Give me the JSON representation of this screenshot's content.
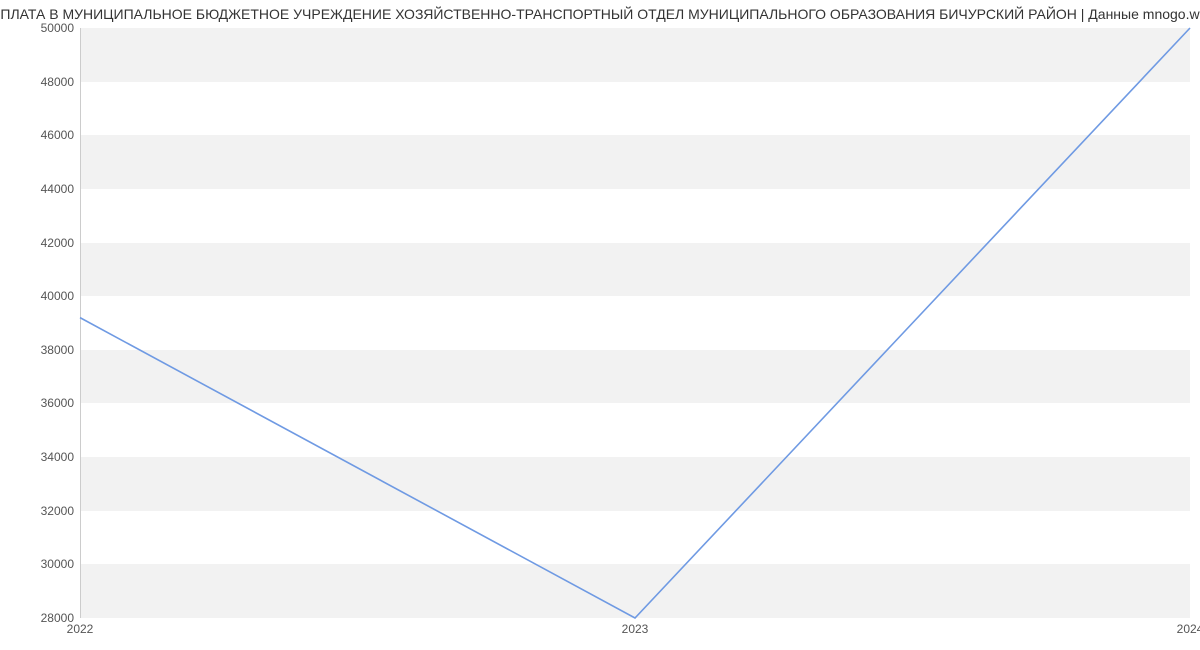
{
  "chart_data": {
    "type": "line",
    "title": "ПЛАТА В МУНИЦИПАЛЬНОЕ БЮДЖЕТНОЕ УЧРЕЖДЕНИЕ ХОЗЯЙСТВЕННО-ТРАНСПОРТНЫЙ ОТДЕЛ МУНИЦИПАЛЬНОГО ОБРАЗОВАНИЯ БИЧУРСКИЙ РАЙОН | Данные mnogo.w",
    "x": [
      2022,
      2023,
      2024
    ],
    "x_labels": [
      "2022",
      "2023",
      "2024"
    ],
    "values": [
      39200,
      28000,
      50000
    ],
    "y_ticks": [
      28000,
      30000,
      32000,
      34000,
      36000,
      38000,
      40000,
      42000,
      44000,
      46000,
      48000,
      50000
    ],
    "ylim": [
      28000,
      50000
    ],
    "xlim": [
      2022,
      2024
    ],
    "xlabel": "",
    "ylabel": "",
    "line_color": "#6f9ae3"
  }
}
